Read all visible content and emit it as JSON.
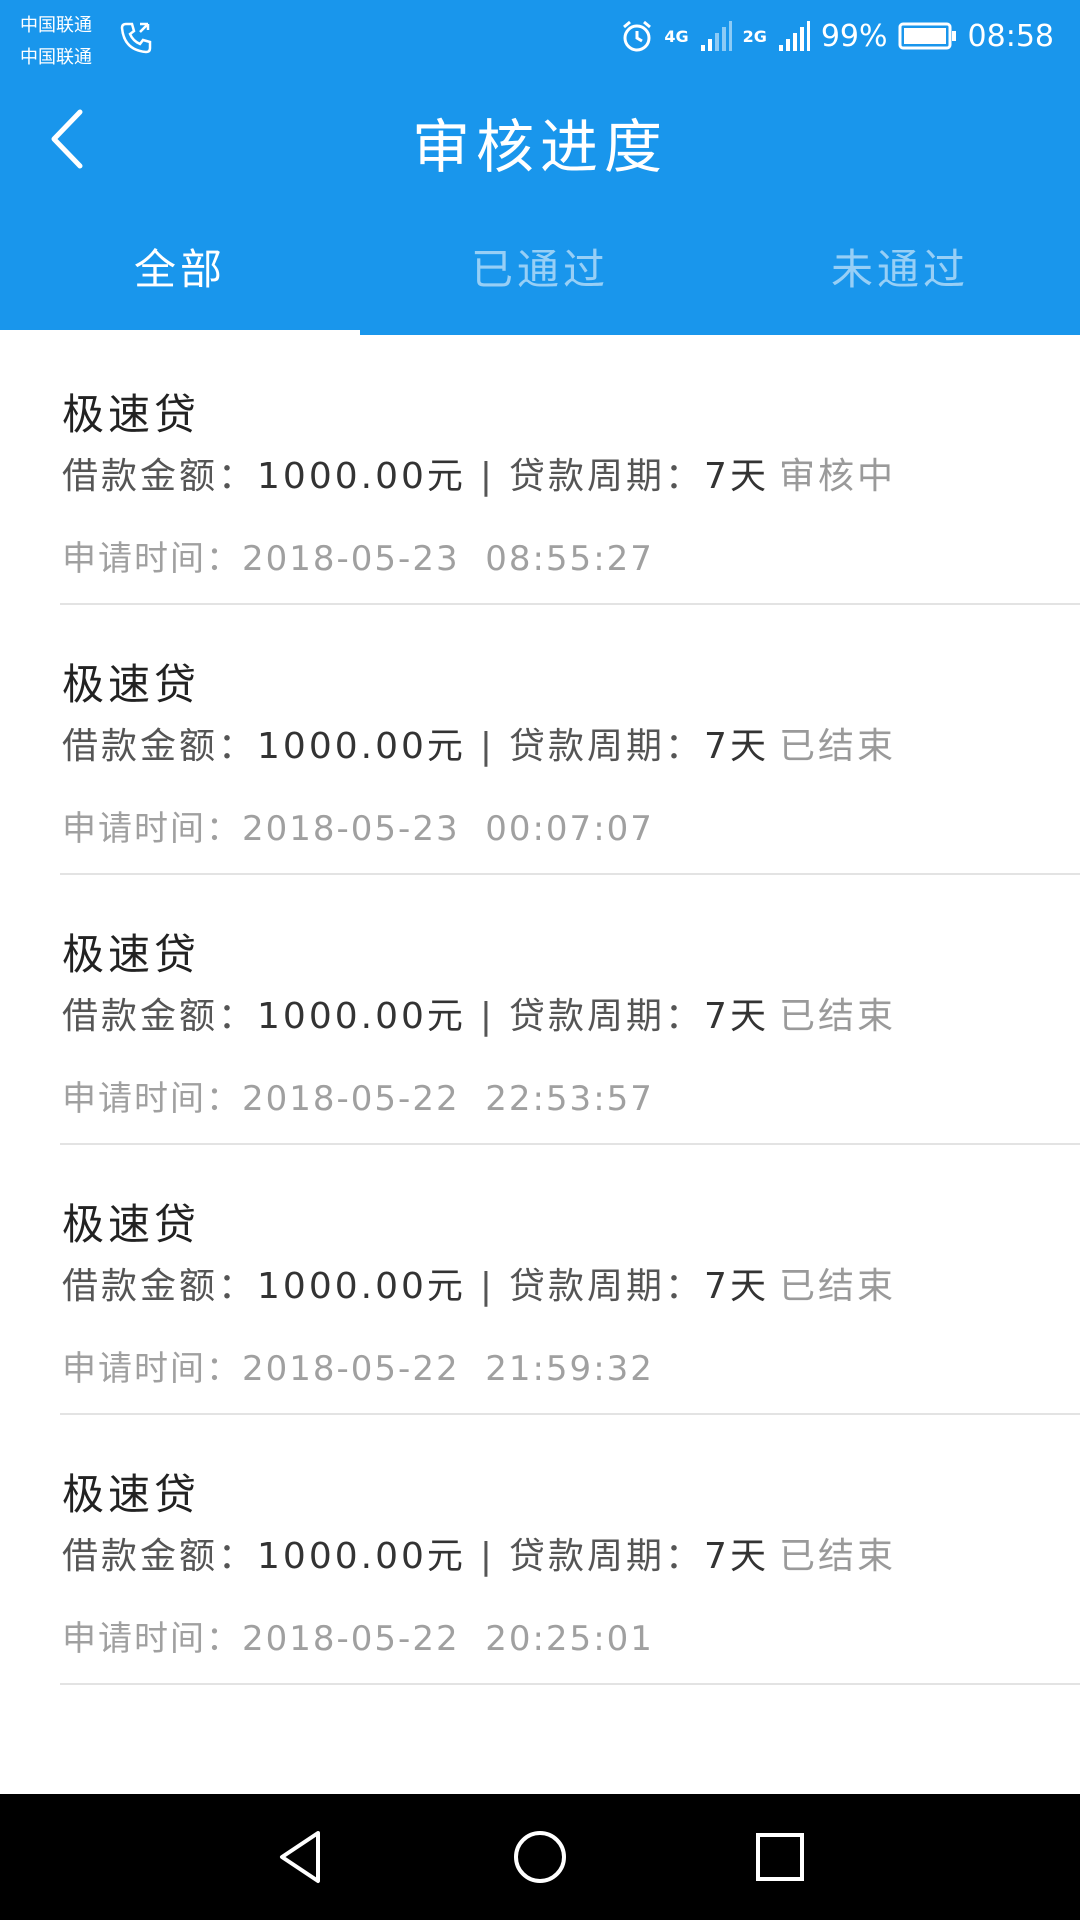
{
  "status_bar": {
    "carrier_1": "中国联通",
    "carrier_2": "中国联通",
    "network_1": "4G",
    "network_2": "2G",
    "battery": "99%",
    "time": "08:58"
  },
  "header": {
    "title": "审核进度",
    "back_icon": "chevron-left-icon"
  },
  "tabs": [
    {
      "label": "全部",
      "active": true
    },
    {
      "label": "已通过",
      "active": false
    },
    {
      "label": "未通过",
      "active": false
    }
  ],
  "colors": {
    "primary": "#1996EC",
    "text_dark": "#222222",
    "text_muted": "#a0a0a0",
    "divider": "#e3e3e3"
  },
  "labels": {
    "amount_label": "借款金额：",
    "period_label": "贷款周期：",
    "time_label": "申请时间：",
    "separator": "|"
  },
  "records": [
    {
      "product": "极速贷",
      "amount": "1000.00元",
      "period": "7天",
      "status": "审核中",
      "apply_time": "2018-05-23  08:55:27"
    },
    {
      "product": "极速贷",
      "amount": "1000.00元",
      "period": "7天",
      "status": "已结束",
      "apply_time": "2018-05-23  00:07:07"
    },
    {
      "product": "极速贷",
      "amount": "1000.00元",
      "period": "7天",
      "status": "已结束",
      "apply_time": "2018-05-22  22:53:57"
    },
    {
      "product": "极速贷",
      "amount": "1000.00元",
      "period": "7天",
      "status": "已结束",
      "apply_time": "2018-05-22  21:59:32"
    },
    {
      "product": "极速贷",
      "amount": "1000.00元",
      "period": "7天",
      "status": "已结束",
      "apply_time": "2018-05-22  20:25:01"
    }
  ],
  "navigation": {
    "back": "triangle-back-icon",
    "home": "circle-home-icon",
    "recents": "square-recents-icon"
  }
}
